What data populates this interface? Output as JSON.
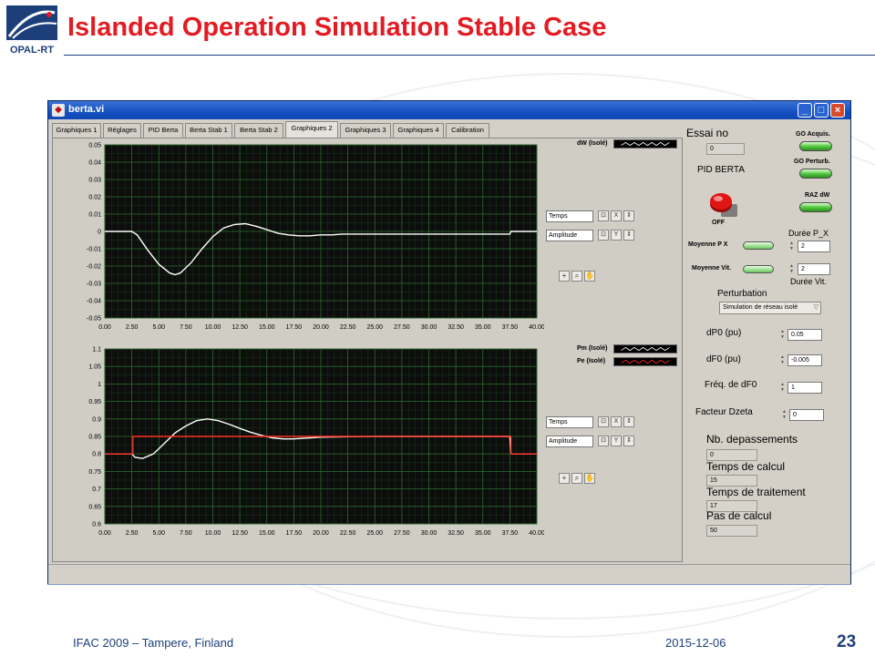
{
  "slide": {
    "title": "Islanded Operation Simulation Stable Case",
    "footer_left": "IFAC 2009 – Tampere, Finland",
    "footer_date": "2015-12-06",
    "page_number": "23",
    "logo_text": "OPAL-RT",
    "title_color": "#e31b23",
    "brand_color": "#1c3f7a"
  },
  "window": {
    "title": "berta.vi",
    "buttons": [
      "minimize-icon",
      "maximize-icon",
      "close-icon"
    ]
  },
  "tabs": [
    {
      "label": "Graphiques 1"
    },
    {
      "label": "Réglages"
    },
    {
      "label": "PID Berta"
    },
    {
      "label": "Berta Stab 1"
    },
    {
      "label": "Berta Stab 2"
    },
    {
      "label": "Graphiques 2",
      "active": true
    },
    {
      "label": "Graphiques 3"
    },
    {
      "label": "Graphiques 4"
    },
    {
      "label": "Calibration"
    }
  ],
  "top_chart": {
    "legend": [
      {
        "name": "dW (Isolé)",
        "color": "#ffffff"
      }
    ],
    "x_scale_label": "Temps",
    "y_scale_label": "Amplitude"
  },
  "bottom_chart": {
    "legend": [
      {
        "name": "Pm (Isolé)",
        "color": "#ffffff"
      },
      {
        "name": "Pe (Isolé)",
        "color": "#ff3020"
      }
    ],
    "x_scale_label": "Temps",
    "y_scale_label": "Amplitude"
  },
  "chart_data": [
    {
      "type": "line",
      "xlim": [
        0,
        40
      ],
      "ylim": [
        -0.05,
        0.05
      ],
      "x_ticks": [
        "0.00",
        "2.50",
        "5.00",
        "7.50",
        "10.00",
        "12.50",
        "15.00",
        "17.50",
        "20.00",
        "22.50",
        "25.00",
        "27.50",
        "30.00",
        "32.50",
        "35.00",
        "37.50",
        "40.00"
      ],
      "y_ticks": [
        "0.05",
        "0.04",
        "0.03",
        "0.02",
        "0.01",
        "0",
        "-0.01",
        "-0.02",
        "-0.03",
        "-0.04",
        "-0.05"
      ],
      "grid": true,
      "series": [
        {
          "name": "dW (Isolé)",
          "color": "#ffffff",
          "x": [
            0,
            2.5,
            3,
            4,
            5,
            6,
            6.5,
            7,
            8,
            9,
            10,
            11,
            12,
            13,
            14,
            15,
            16,
            17,
            18,
            19,
            20,
            21,
            22,
            24,
            26,
            28,
            30,
            32,
            34,
            36,
            37.5,
            37.6,
            40
          ],
          "y": [
            0,
            0,
            -0.002,
            -0.011,
            -0.019,
            -0.024,
            -0.025,
            -0.024,
            -0.018,
            -0.01,
            -0.003,
            0.002,
            0.004,
            0.0045,
            0.003,
            0.001,
            -0.001,
            -0.002,
            -0.0025,
            -0.0025,
            -0.002,
            -0.002,
            -0.0015,
            -0.0015,
            -0.0015,
            -0.0015,
            -0.0015,
            -0.0015,
            -0.0015,
            -0.0015,
            -0.0015,
            0,
            0
          ]
        }
      ]
    },
    {
      "type": "line",
      "xlim": [
        0,
        40
      ],
      "ylim": [
        0.6,
        1.1
      ],
      "x_ticks": [
        "0.00",
        "2.50",
        "5.00",
        "7.50",
        "10.00",
        "12.50",
        "15.00",
        "17.50",
        "20.00",
        "22.50",
        "25.00",
        "27.50",
        "30.00",
        "32.50",
        "35.00",
        "37.50",
        "40.00"
      ],
      "y_ticks": [
        "1.1",
        "1.05",
        "1",
        "0.95",
        "0.9",
        "0.85",
        "0.8",
        "0.75",
        "0.7",
        "0.65",
        "0.6"
      ],
      "grid": true,
      "series": [
        {
          "name": "Pm (Isolé)",
          "color": "#ffffff",
          "x": [
            0,
            2.5,
            2.8,
            3.5,
            4.5,
            5.5,
            6.5,
            7.5,
            8.5,
            9.5,
            10.5,
            11.5,
            12.5,
            13.5,
            14.5,
            15.5,
            16.5,
            17.5,
            18.5,
            20,
            22,
            25,
            28,
            31,
            34,
            37.5,
            37.6,
            40
          ],
          "y": [
            0.8,
            0.8,
            0.79,
            0.787,
            0.8,
            0.83,
            0.86,
            0.88,
            0.895,
            0.9,
            0.895,
            0.885,
            0.873,
            0.862,
            0.853,
            0.846,
            0.843,
            0.843,
            0.845,
            0.848,
            0.849,
            0.85,
            0.85,
            0.85,
            0.85,
            0.85,
            0.8,
            0.8
          ]
        },
        {
          "name": "Pe (Isolé)",
          "color": "#ff3020",
          "x": [
            0,
            2.6,
            2.6,
            37.6,
            37.6,
            40
          ],
          "y": [
            0.8,
            0.8,
            0.85,
            0.85,
            0.8,
            0.8
          ]
        }
      ]
    }
  ],
  "controls": {
    "essai_label": "Essai no",
    "essai_value": "0",
    "pid_label": "PID BERTA",
    "pid_state": "OFF",
    "go_acquis": "GO Acquis.",
    "go_perturb": "GO Perturb.",
    "raz_dw": "RAZ dW",
    "moyenne_px": "Moyenne P X",
    "moyenne_vit": "Moyenne Vit.",
    "duree_px_label": "Durée P_X",
    "duree_px_value": "2",
    "duree_vit_label": "Durée Vit.",
    "duree_vit_value": "2",
    "perturbation_label": "Perturbation",
    "perturbation_value": "Simulation de réseau isolé",
    "dp0_label": "dP0 (pu)",
    "dp0_value": "0.05",
    "df0_label": "dF0 (pu)",
    "df0_value": "-0.005",
    "freq_label": "Fréq. de dF0",
    "freq_value": "1",
    "dzeta_label": "Facteur Dzeta",
    "dzeta_value": "0",
    "nb_label": "Nb. depassements",
    "nb_value": "0",
    "calcul_label": "Temps de calcul",
    "calcul_value": "15",
    "traitement_label": "Temps de traitement",
    "traitement_value": "17",
    "pas_label": "Pas de calcul",
    "pas_value": "50",
    "led_color": "#4cc43a",
    "stop_color": "#e01515"
  }
}
